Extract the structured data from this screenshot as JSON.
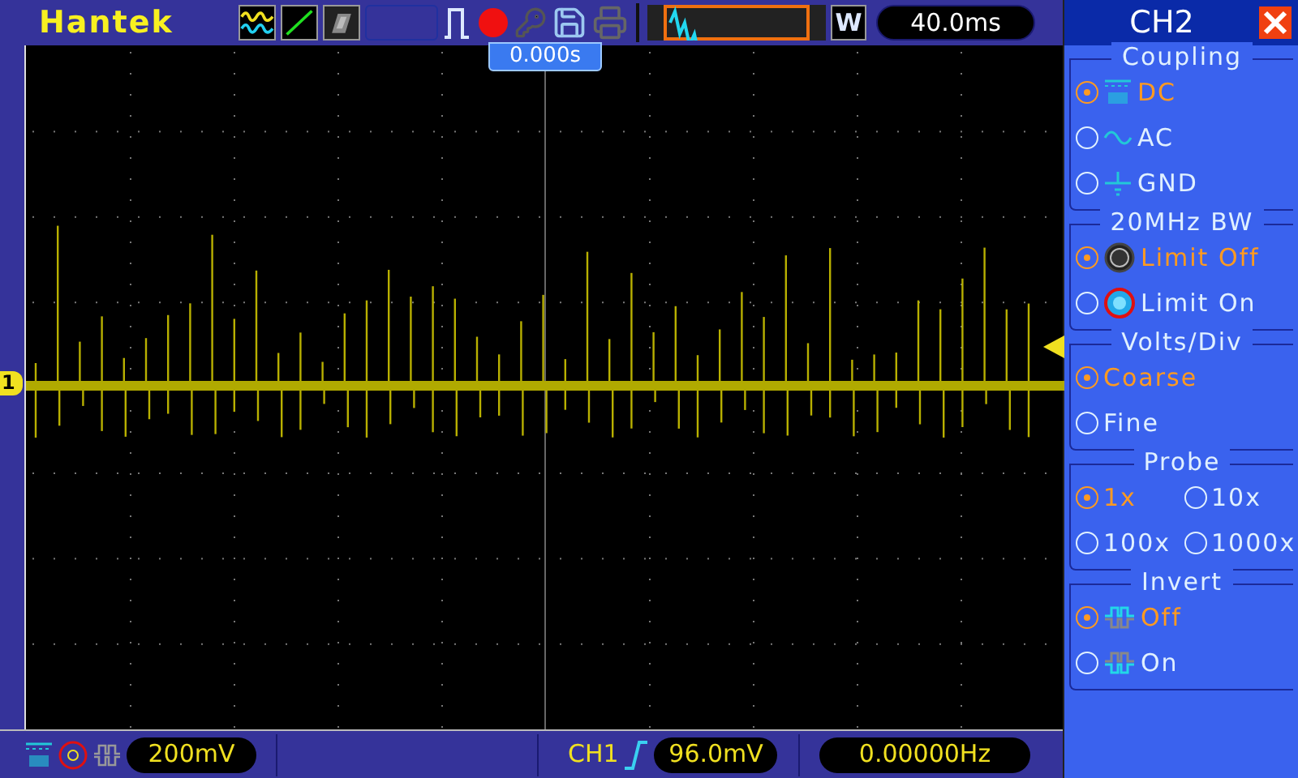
{
  "brand": "Hantek",
  "trigger_position": "0.000s",
  "w_button": "W",
  "timebase": "40.0ms",
  "channel_marker": "1",
  "panel": {
    "title": "CH2",
    "sections": [
      {
        "title": "Coupling",
        "kind": "list",
        "options": [
          {
            "label": "DC",
            "kind": "dc",
            "selected": true
          },
          {
            "label": "AC",
            "kind": "ac",
            "selected": false
          },
          {
            "label": "GND",
            "kind": "gnd",
            "selected": false
          }
        ]
      },
      {
        "title": "20MHz BW",
        "kind": "list",
        "options": [
          {
            "label": "Limit Off",
            "kind": "bw-off",
            "selected": true
          },
          {
            "label": "Limit On",
            "kind": "bw-on",
            "selected": false
          }
        ]
      },
      {
        "title": "Volts/Div",
        "kind": "list",
        "options": [
          {
            "label": "Coarse",
            "selected": true
          },
          {
            "label": "Fine",
            "selected": false
          }
        ]
      },
      {
        "title": "Probe",
        "kind": "grid",
        "options": [
          {
            "label": "1x",
            "selected": true
          },
          {
            "label": "10x",
            "selected": false
          },
          {
            "label": "100x",
            "selected": false
          },
          {
            "label": "1000x",
            "selected": false
          }
        ]
      },
      {
        "title": "Invert",
        "kind": "list",
        "options": [
          {
            "label": "Off",
            "kind": "invert-off",
            "selected": true
          },
          {
            "label": "On",
            "kind": "invert-on",
            "selected": false
          }
        ]
      }
    ]
  },
  "status": {
    "scale": "200mV",
    "trigger_source": "CH1",
    "trigger_level": "96.0mV",
    "frequency": "0.00000Hz"
  }
}
